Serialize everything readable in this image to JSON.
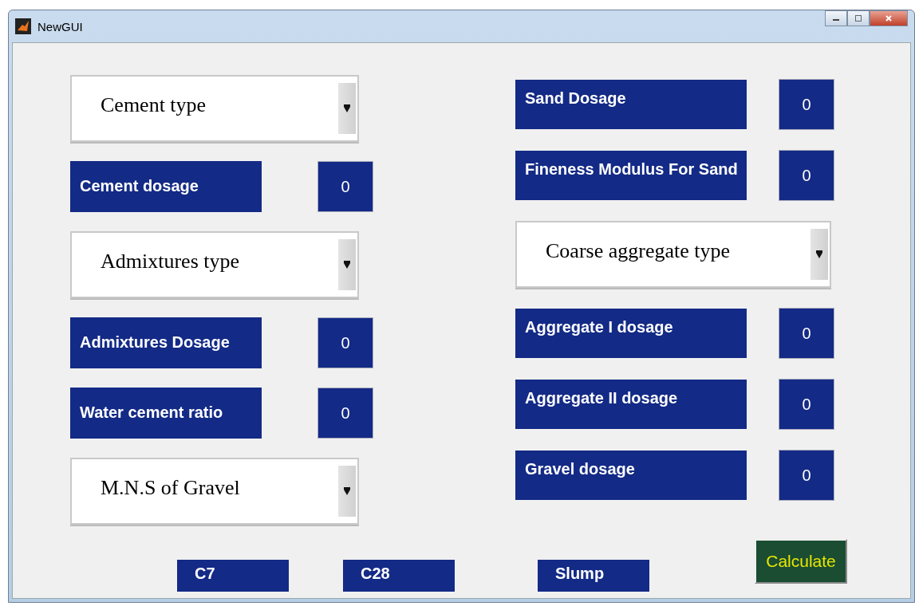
{
  "window": {
    "title": "NewGUI"
  },
  "left": [
    {
      "kind": "dropdown",
      "label": "Cement type"
    },
    {
      "kind": "field",
      "label": "Cement dosage",
      "value": "0"
    },
    {
      "kind": "dropdown",
      "label": "Admixtures type"
    },
    {
      "kind": "field",
      "label": "Admixtures Dosage",
      "value": "0"
    },
    {
      "kind": "field",
      "label": "Water cement ratio",
      "value": "0"
    },
    {
      "kind": "dropdown",
      "label": "M.N.S of Gravel"
    }
  ],
  "right": [
    {
      "kind": "field",
      "label": "Sand  Dosage",
      "value": "0"
    },
    {
      "kind": "field",
      "label": "Fineness Modulus For Sand",
      "value": "0"
    },
    {
      "kind": "dropdown",
      "label": "Coarse aggregate type"
    },
    {
      "kind": "field",
      "label": "Aggregate I dosage",
      "value": "0"
    },
    {
      "kind": "field",
      "label": "Aggregate II dosage",
      "value": "0"
    },
    {
      "kind": "field",
      "label": "Gravel dosage",
      "value": "0"
    }
  ],
  "outputs": [
    "C7",
    "C28",
    "Slump"
  ],
  "button": "Calculate"
}
